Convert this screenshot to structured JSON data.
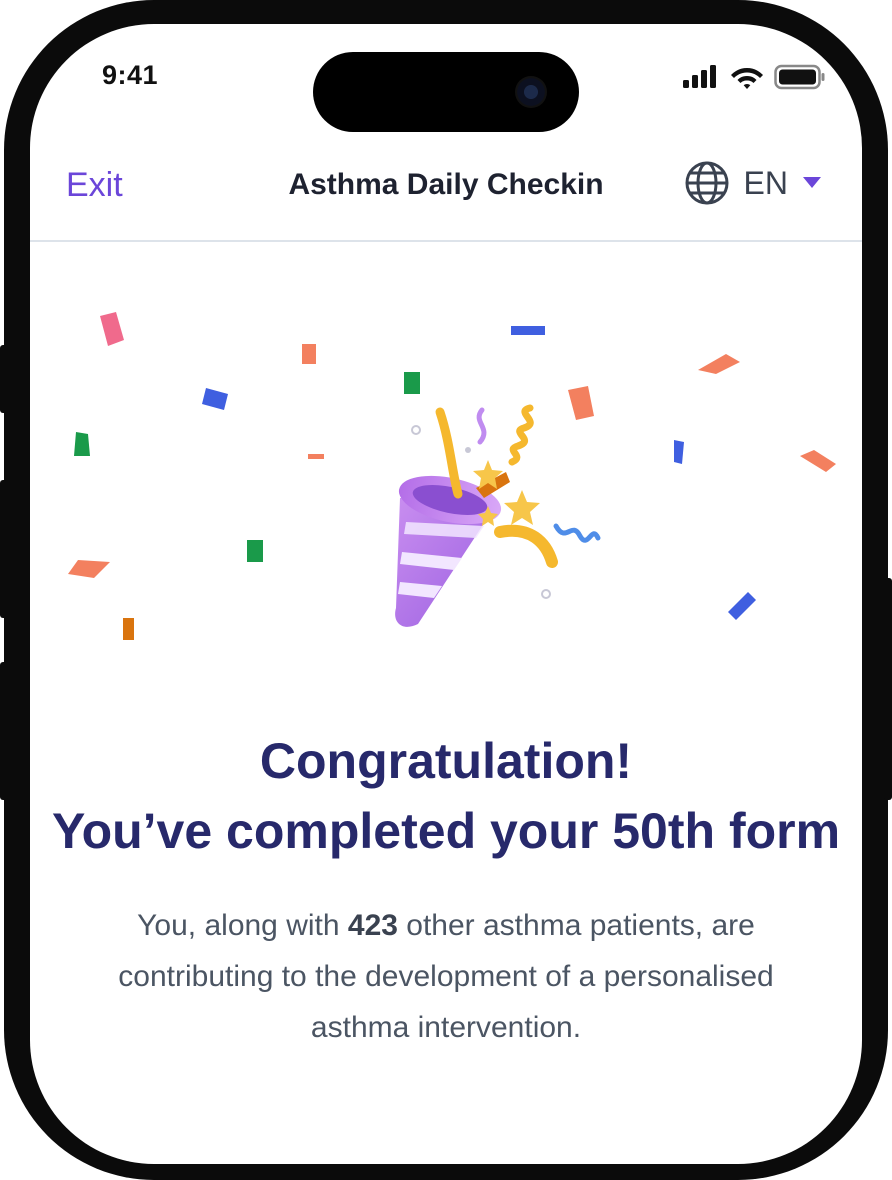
{
  "status_bar": {
    "time": "9:41"
  },
  "header": {
    "exit_label": "Exit",
    "title": "Asthma Daily Checkin",
    "language": "EN"
  },
  "icons": {
    "globe": "globe-icon",
    "dropdown": "caret-down-icon",
    "celebration": "party-popper-icon"
  },
  "colors": {
    "accent": "#6b46d9",
    "heading": "#27296b",
    "body": "#4b5563"
  },
  "celebration": {
    "heading_line1": "Congratulation!",
    "heading_line2": "You’ve completed your 50th form",
    "body_prefix": "You, along with ",
    "patient_count": "423",
    "body_suffix": " other asthma patients, are contributing to the development of a personalised asthma intervention."
  }
}
